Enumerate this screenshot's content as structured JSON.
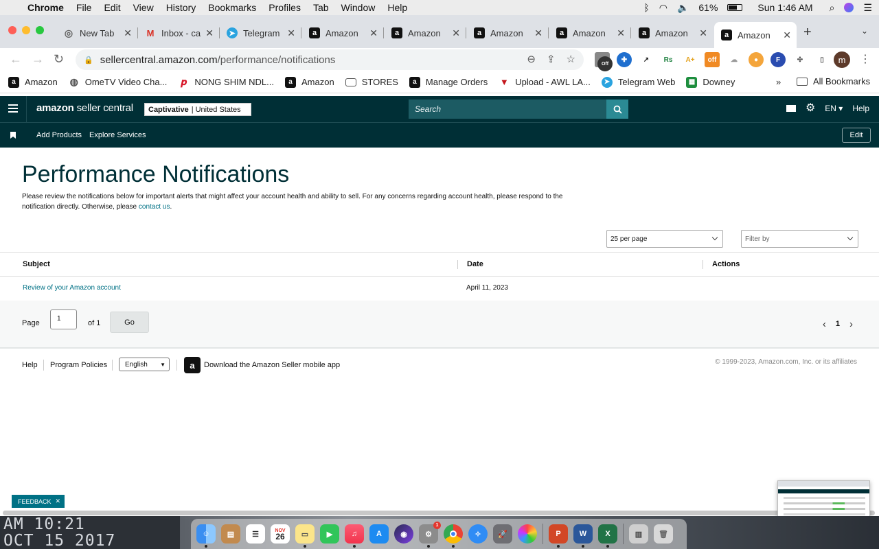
{
  "macos_menubar": {
    "app_name": "Chrome",
    "menus": [
      "File",
      "Edit",
      "View",
      "History",
      "Bookmarks",
      "Profiles",
      "Tab",
      "Window",
      "Help"
    ],
    "battery": "61%",
    "clock": "Sun 1:46 AM"
  },
  "chrome": {
    "tabs": [
      {
        "title": "New Tab",
        "icon": "chrome-icon"
      },
      {
        "title": "Inbox - ca",
        "icon": "gmail-icon"
      },
      {
        "title": "Telegram",
        "icon": "telegram-icon"
      },
      {
        "title": "Amazon",
        "icon": "amazon-icon"
      },
      {
        "title": "Amazon",
        "icon": "amazon-icon"
      },
      {
        "title": "Amazon",
        "icon": "amazon-icon"
      },
      {
        "title": "Amazon",
        "icon": "amazon-icon"
      },
      {
        "title": "Amazon",
        "icon": "amazon-icon"
      },
      {
        "title": "Amazon",
        "icon": "amazon-icon",
        "active": true
      }
    ],
    "url_domain": "sellercentral.amazon.com",
    "url_path": "/performance/notifications",
    "extension_badge_off": "Off",
    "profile_initial": "m",
    "bookmarks": [
      {
        "label": "Amazon",
        "icon": "amazon-icon"
      },
      {
        "label": "OmeTV Video Cha...",
        "icon": "globe-icon"
      },
      {
        "label": "NONG SHIM NDL...",
        "icon": "pinterest-icon"
      },
      {
        "label": "Amazon",
        "icon": "amazon-icon"
      },
      {
        "label": "STORES",
        "icon": "folder-icon"
      },
      {
        "label": "Manage Orders",
        "icon": "amazon-icon"
      },
      {
        "label": "Upload - AWL LA...",
        "icon": "upload-icon"
      },
      {
        "label": "Telegram Web",
        "icon": "telegram-icon"
      },
      {
        "label": "Downey",
        "icon": "sheets-icon"
      }
    ],
    "more_bookmarks": "»",
    "all_bookmarks": "All Bookmarks"
  },
  "seller_header": {
    "logo_bold": "amazon",
    "logo_rest": " seller central",
    "account_name": "Captivative",
    "account_marketplace": "| United States",
    "search_placeholder": "Search",
    "language": "EN",
    "help": "Help",
    "nav_links": [
      "Add Products",
      "Explore Services"
    ],
    "edit_label": "Edit"
  },
  "page": {
    "title": "Performance Notifications",
    "intro_text": "Please review the notifications below for important alerts that might affect your account health and ability to sell. For any concerns regarding account health, please respond to the notification directly. Otherwise, please ",
    "intro_link": "contact us",
    "intro_end": ".",
    "per_page": "25 per page",
    "filter_placeholder": "Filter by",
    "table": {
      "headers": [
        "Subject",
        "Date",
        "Actions"
      ],
      "rows": [
        {
          "subject": "Review of your Amazon account",
          "date": "April 11, 2023",
          "actions": ""
        }
      ]
    },
    "pager": {
      "page_label": "Page",
      "page_value": "1",
      "of_label": "of 1",
      "go_label": "Go",
      "current_page": "1"
    }
  },
  "footer": {
    "links": [
      "Help",
      "Program Policies"
    ],
    "language": "English",
    "app_text": "Download the Amazon Seller mobile app",
    "copyright": "© 1999-2023, Amazon.com, Inc. or its affiliates"
  },
  "feedback_label": "FEEDBACK",
  "desktop_clock": {
    "line1": "AM 10:21",
    "line2": "OCT 15 2017"
  },
  "dock": {
    "calendar_month": "NOV",
    "calendar_day": "26",
    "settings_badge": "1"
  },
  "colors": {
    "seller_header_bg": "#002f36",
    "link": "#007185",
    "search_button": "#2b8a94"
  }
}
